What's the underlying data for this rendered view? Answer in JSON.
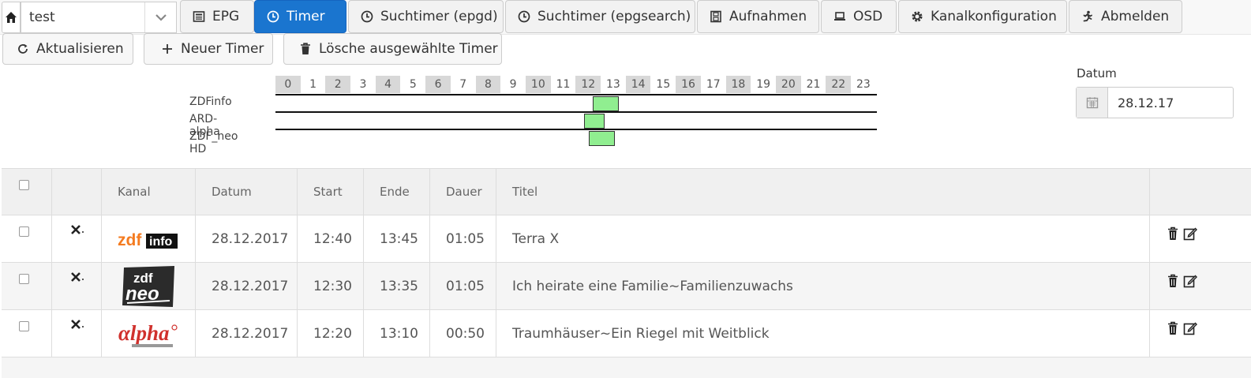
{
  "profile": {
    "value": "test"
  },
  "nav": {
    "epg": "EPG",
    "timer": "Timer",
    "suchtimer_epgd": "Suchtimer (epgd)",
    "suchtimer_epgsearch": "Suchtimer (epgsearch)",
    "aufnahmen": "Aufnahmen",
    "osd": "OSD",
    "kanalkonfiguration": "Kanalkonfiguration",
    "abmelden": "Abmelden"
  },
  "toolbar": {
    "refresh": "Aktualisieren",
    "new_timer": "Neuer Timer",
    "delete_selected": "Lösche ausgewählte Timer"
  },
  "timeline": {
    "hours": [
      "0",
      "1",
      "2",
      "3",
      "4",
      "5",
      "6",
      "7",
      "8",
      "9",
      "10",
      "11",
      "12",
      "13",
      "14",
      "15",
      "16",
      "17",
      "18",
      "19",
      "20",
      "21",
      "22",
      "23"
    ],
    "channels": [
      "ZDFinfo",
      "ARD-alpha",
      "ZDF_neo HD"
    ],
    "block_color": "#90ee90"
  },
  "datum": {
    "label": "Datum",
    "value": "28.12.17"
  },
  "table": {
    "headers": {
      "kanal": "Kanal",
      "datum": "Datum",
      "start": "Start",
      "ende": "Ende",
      "dauer": "Dauer",
      "titel": "Titel"
    },
    "rows": [
      {
        "channel_logo": "zdfinfo-logo",
        "datum": "28.12.2017",
        "start": "12:40",
        "ende": "13:45",
        "dauer": "01:05",
        "titel": "Terra X"
      },
      {
        "channel_logo": "zdfneo-logo",
        "datum": "28.12.2017",
        "start": "12:30",
        "ende": "13:35",
        "dauer": "01:05",
        "titel": "Ich heirate eine Familie~Familienzuwachs"
      },
      {
        "channel_logo": "alpha-logo",
        "datum": "28.12.2017",
        "start": "12:20",
        "ende": "13:10",
        "dauer": "00:50",
        "titel": "Traumhäuser~Ein Riegel mit Weitblick"
      }
    ]
  },
  "colors": {
    "active_tab": "#1a75cf"
  }
}
